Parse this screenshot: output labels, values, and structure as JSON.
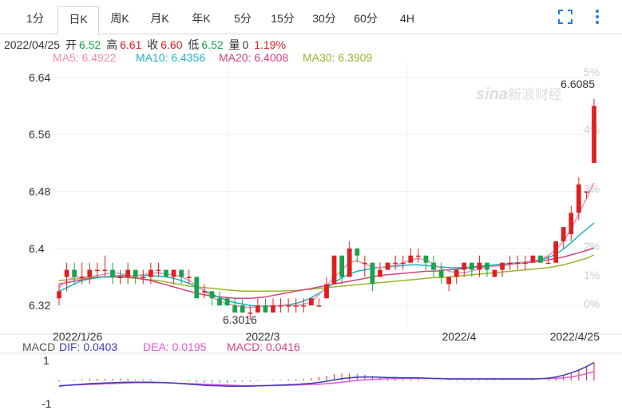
{
  "tabs": [
    {
      "label": "1分"
    },
    {
      "label": "日K"
    },
    {
      "label": "周K"
    },
    {
      "label": "月K"
    },
    {
      "label": "年K"
    },
    {
      "label": "5分"
    },
    {
      "label": "15分"
    },
    {
      "label": "30分"
    },
    {
      "label": "60分"
    },
    {
      "label": "4H"
    }
  ],
  "active_tab": "日K",
  "info": {
    "date": "2022/04/25",
    "open_label": "开",
    "open": "6.52",
    "high_label": "高",
    "high": "6.61",
    "close_label": "收",
    "close": "6.60",
    "low_label": "低",
    "low": "6.52",
    "vol_label": "量",
    "vol": "0",
    "change": "1.19%"
  },
  "ma": {
    "ma5": "MA5: 6.4922",
    "ma10": "MA10: 6.4356",
    "ma20": "MA20: 6.4008",
    "ma30": "MA30: 6.3909"
  },
  "macd_legend": {
    "macd_title": "MACD",
    "dif": "DIF: 0.0403",
    "dea": "DEA: 0.0195",
    "macd": "MACD: 0.0416"
  },
  "watermark": {
    "brand": "sina",
    "name": "新浪财经"
  },
  "colors": {
    "up": "#e02020",
    "down": "#1aa34a",
    "ma5": "#f08fb1",
    "ma10": "#1cb4c7",
    "ma20": "#d4447c",
    "ma30": "#9ab52a",
    "dif": "#3b3fb8",
    "dea": "#e05ad8",
    "grid": "#eef0f3"
  },
  "chart_data": {
    "type": "candlestick",
    "x_ticks": [
      "2022/1/26",
      "2022/3",
      "2022/4",
      "2022/4/25"
    ],
    "y_ticks": [
      "6.64",
      "6.56",
      "6.48",
      "6.4",
      "6.32"
    ],
    "ylim": [
      6.3,
      6.65
    ],
    "pct_ticks": [
      "5%",
      "4%",
      "3%",
      "2%",
      "1%",
      "0%"
    ],
    "annotations": {
      "high_label": "6.6085",
      "low_label": "6.3016"
    },
    "macd_ticks": [
      "1",
      "-1"
    ],
    "candles": [
      [
        6.33,
        6.34,
        6.35,
        6.32
      ],
      [
        6.36,
        6.37,
        6.38,
        6.34
      ],
      [
        6.37,
        6.36,
        6.38,
        6.35
      ],
      [
        6.36,
        6.36,
        6.38,
        6.35
      ],
      [
        6.36,
        6.37,
        6.38,
        6.35
      ],
      [
        6.37,
        6.37,
        6.38,
        6.36
      ],
      [
        6.37,
        6.37,
        6.39,
        6.36
      ],
      [
        6.37,
        6.36,
        6.38,
        6.35
      ],
      [
        6.36,
        6.36,
        6.37,
        6.35
      ],
      [
        6.36,
        6.37,
        6.38,
        6.35
      ],
      [
        6.37,
        6.36,
        6.37,
        6.35
      ],
      [
        6.36,
        6.36,
        6.37,
        6.35
      ],
      [
        6.36,
        6.37,
        6.38,
        6.35
      ],
      [
        6.37,
        6.37,
        6.38,
        6.36
      ],
      [
        6.37,
        6.36,
        6.37,
        6.36
      ],
      [
        6.36,
        6.37,
        6.37,
        6.35
      ],
      [
        6.37,
        6.36,
        6.37,
        6.35
      ],
      [
        6.36,
        6.36,
        6.37,
        6.35
      ],
      [
        6.36,
        6.33,
        6.36,
        6.33
      ],
      [
        6.34,
        6.34,
        6.35,
        6.33
      ],
      [
        6.34,
        6.33,
        6.34,
        6.32
      ],
      [
        6.33,
        6.32,
        6.34,
        6.32
      ],
      [
        6.33,
        6.32,
        6.33,
        6.32
      ],
      [
        6.32,
        6.31,
        6.33,
        6.31
      ],
      [
        6.32,
        6.31,
        6.33,
        6.31
      ],
      [
        6.31,
        6.31,
        6.32,
        6.3
      ],
      [
        6.31,
        6.32,
        6.33,
        6.31
      ],
      [
        6.32,
        6.31,
        6.33,
        6.31
      ],
      [
        6.31,
        6.32,
        6.33,
        6.31
      ],
      [
        6.32,
        6.32,
        6.33,
        6.31
      ],
      [
        6.32,
        6.32,
        6.33,
        6.31
      ],
      [
        6.32,
        6.32,
        6.33,
        6.31
      ],
      [
        6.32,
        6.32,
        6.33,
        6.31
      ],
      [
        6.32,
        6.33,
        6.33,
        6.32
      ],
      [
        6.32,
        6.32,
        6.33,
        6.32
      ],
      [
        6.33,
        6.35,
        6.36,
        6.33
      ],
      [
        6.35,
        6.39,
        6.39,
        6.35
      ],
      [
        6.39,
        6.36,
        6.39,
        6.35
      ],
      [
        6.36,
        6.4,
        6.41,
        6.36
      ],
      [
        6.4,
        6.39,
        6.4,
        6.38
      ],
      [
        6.38,
        6.38,
        6.39,
        6.36
      ],
      [
        6.38,
        6.35,
        6.38,
        6.34
      ],
      [
        6.36,
        6.37,
        6.38,
        6.36
      ],
      [
        6.37,
        6.38,
        6.38,
        6.37
      ],
      [
        6.38,
        6.38,
        6.39,
        6.37
      ],
      [
        6.38,
        6.38,
        6.39,
        6.37
      ],
      [
        6.38,
        6.39,
        6.4,
        6.38
      ],
      [
        6.39,
        6.39,
        6.4,
        6.38
      ],
      [
        6.39,
        6.38,
        6.39,
        6.37
      ],
      [
        6.38,
        6.37,
        6.39,
        6.36
      ],
      [
        6.37,
        6.36,
        6.38,
        6.35
      ],
      [
        6.35,
        6.36,
        6.36,
        6.34
      ],
      [
        6.36,
        6.37,
        6.37,
        6.35
      ],
      [
        6.37,
        6.38,
        6.38,
        6.36
      ],
      [
        6.38,
        6.37,
        6.38,
        6.36
      ],
      [
        6.37,
        6.38,
        6.39,
        6.36
      ],
      [
        6.38,
        6.37,
        6.38,
        6.36
      ],
      [
        6.36,
        6.37,
        6.37,
        6.36
      ],
      [
        6.37,
        6.38,
        6.38,
        6.36
      ],
      [
        6.38,
        6.38,
        6.39,
        6.37
      ],
      [
        6.38,
        6.38,
        6.39,
        6.37
      ],
      [
        6.38,
        6.38,
        6.39,
        6.37
      ],
      [
        6.38,
        6.39,
        6.39,
        6.38
      ],
      [
        6.39,
        6.38,
        6.39,
        6.38
      ],
      [
        6.38,
        6.38,
        6.39,
        6.38
      ],
      [
        6.38,
        6.41,
        6.41,
        6.38
      ],
      [
        6.41,
        6.43,
        6.43,
        6.4
      ],
      [
        6.42,
        6.45,
        6.46,
        6.41
      ],
      [
        6.45,
        6.49,
        6.5,
        6.44
      ],
      [
        6.48,
        6.48,
        6.48,
        6.47
      ],
      [
        6.52,
        6.6,
        6.61,
        6.52
      ]
    ],
    "ma5": [
      6.345,
      6.355,
      6.36,
      6.36,
      6.36,
      6.362,
      6.364,
      6.366,
      6.365,
      6.362,
      6.362,
      6.363,
      6.365,
      6.366,
      6.364,
      6.363,
      6.36,
      6.355,
      6.348,
      6.34,
      6.332,
      6.326,
      6.322,
      6.32,
      6.318,
      6.317,
      6.318,
      6.319,
      6.32,
      6.32,
      6.32,
      6.32,
      6.322,
      6.325,
      6.335,
      6.347,
      6.36,
      6.37,
      6.38,
      6.383,
      6.378,
      6.374,
      6.373,
      6.375,
      6.376,
      6.38,
      6.384,
      6.386,
      6.384,
      6.378,
      6.372,
      6.368,
      6.366,
      6.366,
      6.368,
      6.372,
      6.374,
      6.375,
      6.376,
      6.377,
      6.379,
      6.381,
      6.382,
      6.385,
      6.39,
      6.398,
      6.41,
      6.427,
      6.449,
      6.47,
      6.492
    ],
    "ma10": [
      6.34,
      6.345,
      6.35,
      6.355,
      6.357,
      6.359,
      6.36,
      6.361,
      6.362,
      6.362,
      6.362,
      6.362,
      6.362,
      6.361,
      6.36,
      6.358,
      6.355,
      6.351,
      6.346,
      6.341,
      6.336,
      6.331,
      6.327,
      6.324,
      6.322,
      6.32,
      6.319,
      6.319,
      6.319,
      6.32,
      6.321,
      6.323,
      6.326,
      6.331,
      6.337,
      6.344,
      6.352,
      6.359,
      6.364,
      6.368,
      6.37,
      6.372,
      6.373,
      6.374,
      6.375,
      6.376,
      6.377,
      6.377,
      6.376,
      6.375,
      6.374,
      6.373,
      6.373,
      6.373,
      6.374,
      6.375,
      6.376,
      6.377,
      6.378,
      6.379,
      6.38,
      6.381,
      6.382,
      6.384,
      6.387,
      6.392,
      6.399,
      6.408,
      6.418,
      6.427,
      6.4356
    ],
    "ma20": [
      6.35,
      6.352,
      6.354,
      6.356,
      6.358,
      6.359,
      6.36,
      6.36,
      6.36,
      6.36,
      6.359,
      6.357,
      6.355,
      6.352,
      6.349,
      6.346,
      6.343,
      6.34,
      6.337,
      6.335,
      6.333,
      6.332,
      6.331,
      6.33,
      6.33,
      6.33,
      6.331,
      6.332,
      6.334,
      6.336,
      6.338,
      6.34,
      6.342,
      6.344,
      6.346,
      6.348,
      6.35,
      6.352,
      6.354,
      6.356,
      6.358,
      6.36,
      6.362,
      6.363,
      6.364,
      6.365,
      6.366,
      6.367,
      6.368,
      6.368,
      6.369,
      6.37,
      6.371,
      6.372,
      6.373,
      6.374,
      6.375,
      6.376,
      6.377,
      6.378,
      6.379,
      6.38,
      6.381,
      6.382,
      6.384,
      6.386,
      6.388,
      6.391,
      6.394,
      6.397,
      6.4008
    ],
    "ma30": [
      6.355,
      6.356,
      6.357,
      6.358,
      6.359,
      6.36,
      6.36,
      6.36,
      6.36,
      6.359,
      6.358,
      6.357,
      6.356,
      6.355,
      6.353,
      6.351,
      6.349,
      6.347,
      6.346,
      6.345,
      6.344,
      6.343,
      6.342,
      6.341,
      6.34,
      6.34,
      6.34,
      6.34,
      6.34,
      6.34,
      6.341,
      6.341,
      6.342,
      6.343,
      6.344,
      6.345,
      6.346,
      6.347,
      6.348,
      6.349,
      6.35,
      6.351,
      6.352,
      6.353,
      6.354,
      6.355,
      6.356,
      6.357,
      6.358,
      6.359,
      6.359,
      6.36,
      6.361,
      6.362,
      6.363,
      6.364,
      6.365,
      6.366,
      6.367,
      6.368,
      6.369,
      6.37,
      6.371,
      6.372,
      6.373,
      6.375,
      6.377,
      6.38,
      6.383,
      6.386,
      6.3909
    ],
    "dif": [
      -0.2,
      -0.17,
      -0.15,
      -0.13,
      -0.11,
      -0.1,
      -0.09,
      -0.08,
      -0.07,
      -0.06,
      -0.06,
      -0.06,
      -0.06,
      -0.07,
      -0.08,
      -0.09,
      -0.11,
      -0.13,
      -0.15,
      -0.17,
      -0.18,
      -0.19,
      -0.2,
      -0.2,
      -0.2,
      -0.2,
      -0.19,
      -0.18,
      -0.17,
      -0.16,
      -0.15,
      -0.14,
      -0.12,
      -0.1,
      -0.07,
      -0.03,
      0.02,
      0.06,
      0.09,
      0.11,
      0.12,
      0.12,
      0.11,
      0.1,
      0.1,
      0.09,
      0.09,
      0.09,
      0.08,
      0.07,
      0.06,
      0.05,
      0.05,
      0.05,
      0.05,
      0.05,
      0.05,
      0.05,
      0.05,
      0.05,
      0.05,
      0.05,
      0.05,
      0.06,
      0.08,
      0.12,
      0.18,
      0.26,
      0.36,
      0.48,
      0.62
    ],
    "dea": [
      -0.18,
      -0.17,
      -0.16,
      -0.15,
      -0.14,
      -0.13,
      -0.12,
      -0.11,
      -0.1,
      -0.09,
      -0.08,
      -0.08,
      -0.08,
      -0.08,
      -0.08,
      -0.09,
      -0.1,
      -0.11,
      -0.12,
      -0.13,
      -0.14,
      -0.15,
      -0.16,
      -0.17,
      -0.18,
      -0.18,
      -0.18,
      -0.18,
      -0.18,
      -0.17,
      -0.17,
      -0.16,
      -0.15,
      -0.14,
      -0.13,
      -0.11,
      -0.09,
      -0.06,
      -0.03,
      0.0,
      0.02,
      0.04,
      0.05,
      0.06,
      0.06,
      0.07,
      0.07,
      0.07,
      0.07,
      0.07,
      0.07,
      0.06,
      0.06,
      0.06,
      0.06,
      0.06,
      0.06,
      0.06,
      0.06,
      0.06,
      0.06,
      0.06,
      0.06,
      0.06,
      0.06,
      0.07,
      0.09,
      0.12,
      0.17,
      0.23,
      0.31
    ]
  }
}
